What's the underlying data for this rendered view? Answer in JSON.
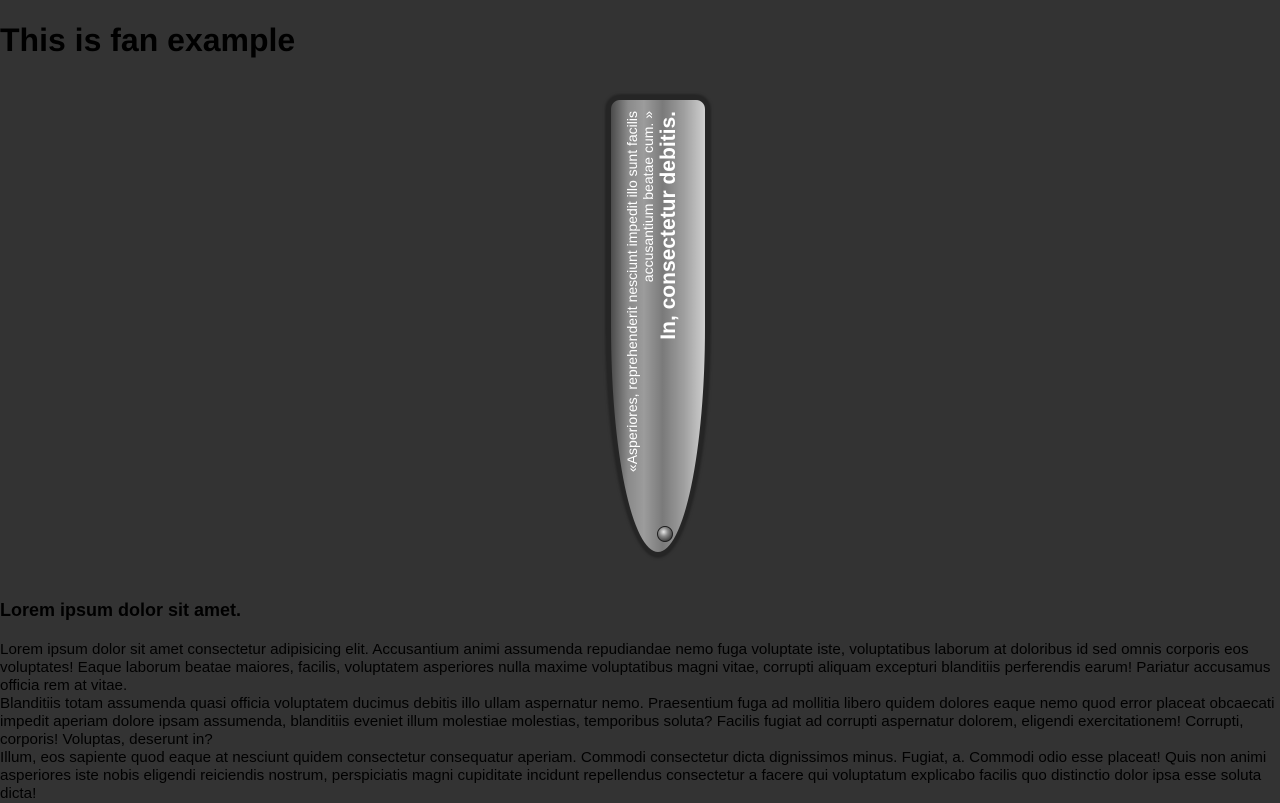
{
  "page": {
    "title": "This is fan example"
  },
  "fan": {
    "quote": "«Asperiores, reprehenderit nesciunt impedit illo sunt facilis accusantium beatae cum. »",
    "heading": "In, consectetur debitis.",
    "pivot_icon": "pin-icon"
  },
  "article": {
    "heading": "Lorem ipsum dolor sit amet.",
    "paragraphs": [
      "Lorem ipsum dolor sit amet consectetur adipisicing elit. Accusantium animi assumenda repudiandae nemo fuga voluptate iste, voluptatibus laborum at doloribus id sed omnis corporis eos voluptates! Eaque laborum beatae maiores, facilis, voluptatem asperiores nulla maxime voluptatibus magni vitae, corrupti aliquam excepturi blanditiis perferendis earum! Pariatur accusamus officia rem at vitae.",
      "Blanditiis totam assumenda quasi officia voluptatem ducimus debitis illo ullam aspernatur nemo. Praesentium fuga ad mollitia libero quidem dolores eaque nemo quod error placeat obcaecati impedit aperiam dolore ipsam assumenda, blanditiis eveniet illum molestiae molestias, temporibus soluta? Facilis fugiat ad corrupti aspernatur dolorem, eligendi exercitationem! Corrupti, corporis! Voluptas, deserunt in?",
      "Illum, eos sapiente quod eaque at nesciunt quidem consectetur consequatur aperiam. Commodi consectetur dicta dignissimos minus. Fugiat, a. Commodi odio esse placeat! Quis non animi asperiores iste nobis eligendi reiciendis nostrum, perspiciatis magni cupiditate incidunt repellendus consectetur a facere qui voluptatum explicabo facilis quo distinctio dolor ipsa esse soluta dicta!"
    ]
  },
  "colors": {
    "background": "#333333",
    "text": "#000000",
    "fan_text": "#ffffff",
    "fan_border": "#252525"
  }
}
